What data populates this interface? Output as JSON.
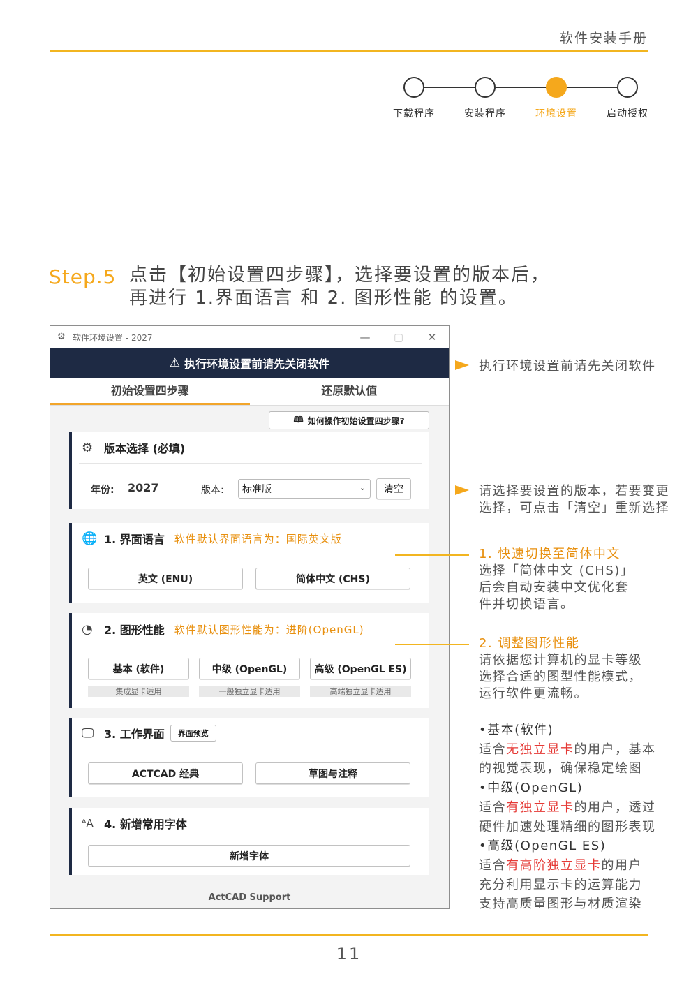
{
  "header": {
    "title": "软件安装手册"
  },
  "stepper": [
    {
      "label": "下载程序",
      "active": false
    },
    {
      "label": "安装程序",
      "active": false
    },
    {
      "label": "环境设置",
      "active": true
    },
    {
      "label": "启动授权",
      "active": false
    }
  ],
  "step": {
    "number": "Step.5",
    "line1": "点击【初始设置四步骤】，选择要设置的版本后，",
    "line2": "再进行 1.界面语言 和 2. 图形性能 的设置。"
  },
  "window": {
    "title": "软件环境设置 - 2027",
    "controls": {
      "minimize": "—",
      "maximize": "▢",
      "close": "✕"
    },
    "banner": "执行环境设置前请先关闭软件",
    "tabs": [
      "初始设置四步骤",
      "还原默认值"
    ],
    "howto_button": "如何操作初始设置四步骤?",
    "version_card": {
      "title": "版本选择 (必填)",
      "year_label": "年份:",
      "year_value": "2027",
      "edition_label": "版本:",
      "edition_value": "标准版",
      "clear_button": "清空"
    },
    "language_card": {
      "title": "1. 界面语言",
      "note": "软件默认界面语言为：国际英文版",
      "buttons": [
        "英文 (ENU)",
        "简体中文 (CHS)"
      ]
    },
    "graphics_card": {
      "title": "2. 图形性能",
      "note": "软件默认图形性能为：进阶(OpenGL)",
      "buttons": [
        "基本 (软件)",
        "中级 (OpenGL)",
        "高级 (OpenGL ES)"
      ],
      "captions": [
        "集成显卡适用",
        "一般独立显卡适用",
        "高端独立显卡适用"
      ]
    },
    "workspace_card": {
      "title": "3. 工作界面",
      "preview_button": "界面预览",
      "buttons": [
        "ACTCAD 经典",
        "草图与注释"
      ]
    },
    "font_card": {
      "title": "4. 新增常用字体",
      "button": "新增字体"
    },
    "footer": "ActCAD Support"
  },
  "annotations": {
    "a1": "执行环境设置前请先关闭软件",
    "a2_line1": "请选择要设置的版本，若要变更",
    "a2_line2": "选择，可点击「清空」重新选择",
    "a3_title": "1. 快速切换至简体中文",
    "a3_line1": "选择「简体中文 (CHS)」",
    "a3_line2": "后会自动安装中文优化套",
    "a3_line3": "件并切换语言。",
    "a4_title": "2. 调整图形性能",
    "a4_line1": "请依据您计算机的显卡等级",
    "a4_line2": "选择合适的图型性能模式，",
    "a4_line3": "运行软件更流畅。",
    "basic_title": "•基本(软件)",
    "basic_pre": "适合",
    "basic_red": "无独立显卡",
    "basic_post": "的用户，基本",
    "basic_line2": "的视觉表现，确保稳定绘图",
    "mid_title": "•中级(OpenGL)",
    "mid_pre": "适合",
    "mid_red": "有独立显卡",
    "mid_post": "的用户，透过",
    "mid_line2": "硬件加速处理精细的图形表现",
    "high_title": "•高级(OpenGL ES)",
    "high_pre": "适合",
    "high_red": "有高阶独立显卡",
    "high_post": "的用户",
    "high_line2": "充分利用显示卡的运算能力",
    "high_line3": "支持高质量图形与材质渲染"
  },
  "page_number": "11",
  "colors": {
    "accent": "#f5a81c",
    "navy": "#1e2a44",
    "red": "#e53935"
  }
}
